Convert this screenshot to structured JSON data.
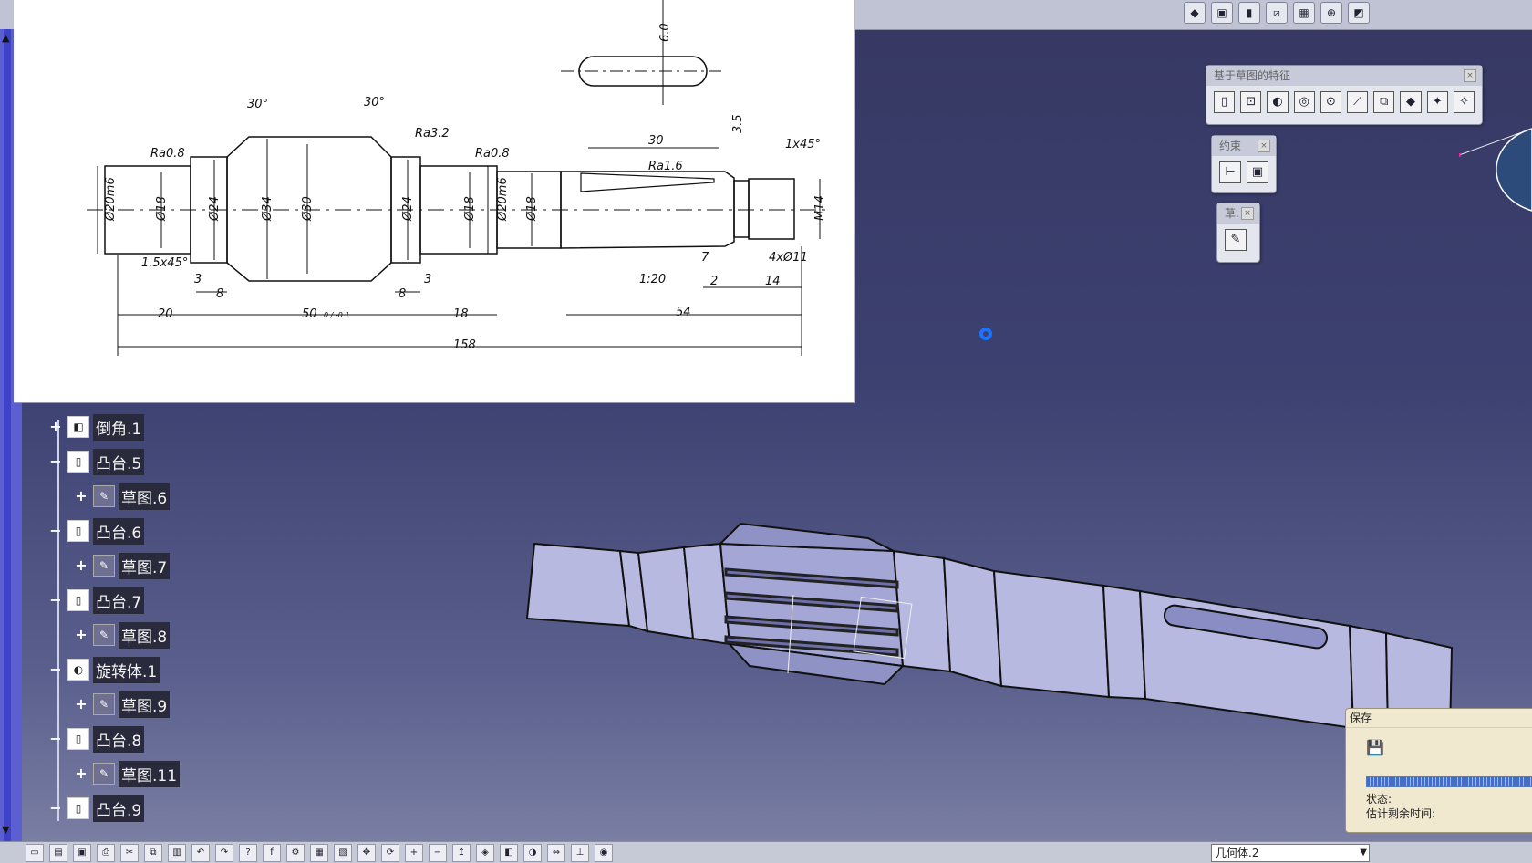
{
  "drawing": {
    "dims": [
      "Ø20m6",
      "Ø18",
      "Ø24",
      "Ø34",
      "Ø30",
      "Ø24",
      "Ø18",
      "Ø20m6",
      "Ø18",
      "M14"
    ],
    "roughness": [
      "Ra0.8",
      "Ra3.2",
      "Ra0.8",
      "Ra1.6"
    ],
    "angles": [
      "30°",
      "30°"
    ],
    "chamfers": [
      "1.5x45°",
      "1x45°"
    ],
    "lengths": {
      "l20": "20",
      "l50": "50",
      "l50tol": "0 / -0.1",
      "l18": "18",
      "l54": "54",
      "l158": "158",
      "l3a": "3",
      "l8a": "8",
      "l8b": "8",
      "l3b": "3",
      "l7": "7",
      "l2": "2",
      "l14": "14",
      "l35": "3.5",
      "l30": "30",
      "hole": "4xØ11",
      "taper": "1:20",
      "key": "6.0"
    }
  },
  "tree": [
    {
      "label": "倒角.1",
      "icon": "chamfer-icon",
      "expand": "+"
    },
    {
      "label": "凸台.5",
      "icon": "pad-icon",
      "expand": "−"
    },
    {
      "label": "草图.6",
      "icon": "sketch-icon",
      "expand": "+"
    },
    {
      "label": "凸台.6",
      "icon": "pad-icon",
      "expand": "−"
    },
    {
      "label": "草图.7",
      "icon": "sketch-icon",
      "expand": "+"
    },
    {
      "label": "凸台.7",
      "icon": "pad-icon",
      "expand": "−"
    },
    {
      "label": "草图.8",
      "icon": "sketch-icon",
      "expand": "+"
    },
    {
      "label": "旋转体.1",
      "icon": "shaft-icon",
      "expand": "−"
    },
    {
      "label": "草图.9",
      "icon": "sketch-icon",
      "expand": "+"
    },
    {
      "label": "凸台.8",
      "icon": "pad-icon",
      "expand": "−"
    },
    {
      "label": "草图.11",
      "icon": "sketch-icon",
      "expand": "+"
    },
    {
      "label": "凸台.9",
      "icon": "pad-icon",
      "expand": "−"
    }
  ],
  "panels": {
    "sketch_features": {
      "title": "基于草图的特征"
    },
    "constraint": {
      "title": "约束"
    },
    "sketch": {
      "title": "草."
    }
  },
  "save_dialog": {
    "title": "保存",
    "status": "状态:",
    "remaining": "估计剩余时间:"
  },
  "bottombar": {
    "select_value": "几何体.2"
  },
  "colors": {
    "background": "#3d4171",
    "tree_label_bg": "#292b3c",
    "save_dialog_bg": "#f0e9cf",
    "cursor": "#1a73ff"
  }
}
